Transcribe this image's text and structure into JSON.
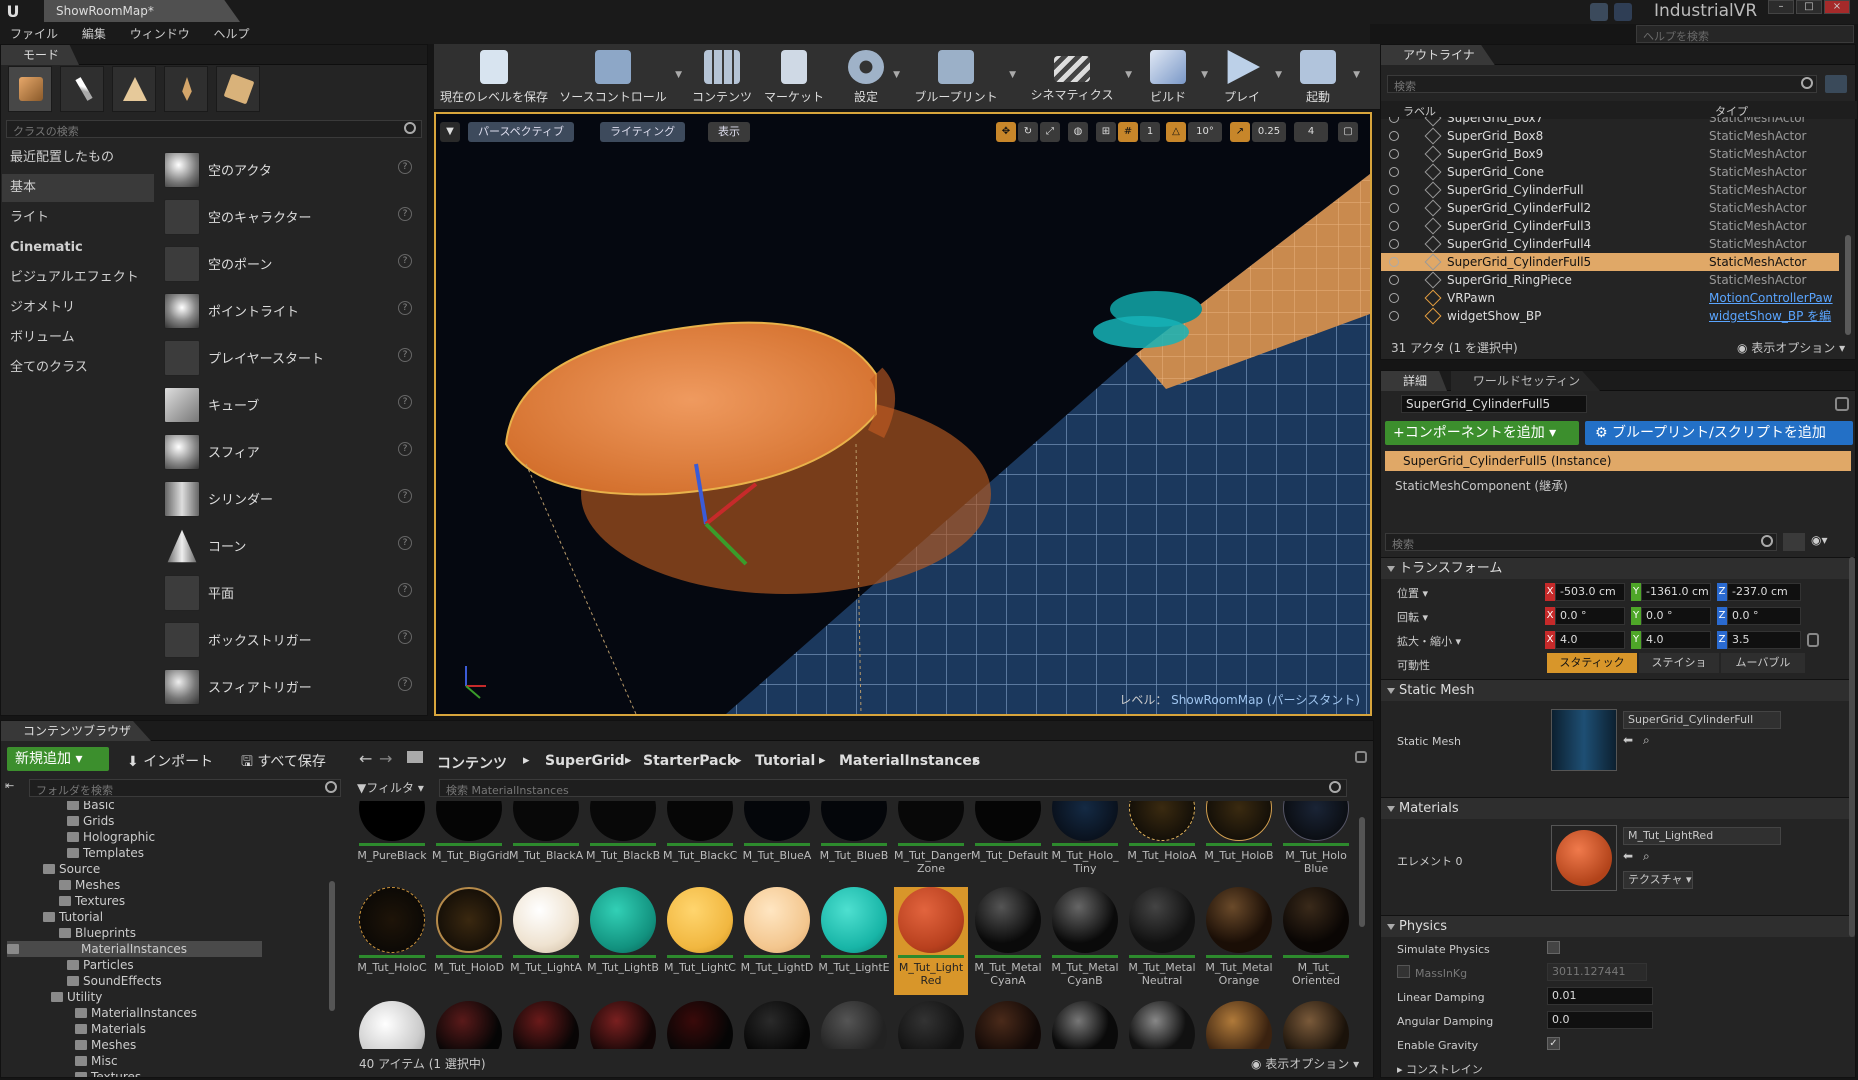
{
  "window": {
    "doc_tab": "ShowRoomMap*",
    "project_name": "IndustrialVR",
    "help_search_placeholder": "ヘルプを検索"
  },
  "menu": [
    "ファイル",
    "編集",
    "ウィンドウ",
    "ヘルプ"
  ],
  "modes": {
    "tab": "モード",
    "search_placeholder": "クラスの検索",
    "categories": [
      "最近配置したもの",
      "基本",
      "ライト",
      "Cinematic",
      "ビジュアルエフェクト",
      "ジオメトリ",
      "ボリューム",
      "全てのクラス"
    ],
    "items": [
      "空のアクタ",
      "空のキャラクター",
      "空のポーン",
      "ポイントライト",
      "プレイヤースタート",
      "キューブ",
      "スフィア",
      "シリンダー",
      "コーン",
      "平面",
      "ボックストリガー",
      "スフィアトリガー"
    ]
  },
  "toolbar": [
    "現在のレベルを保存",
    "ソースコントロール",
    "コンテンツ",
    "マーケット",
    "設定",
    "ブループリント",
    "シネマティクス",
    "ビルド",
    "プレイ",
    "起動"
  ],
  "viewport": {
    "perspective": "パースペクティブ",
    "lighting": "ライティング",
    "show": "表示",
    "rot_snap": "10°",
    "scale_snap": "0.25",
    "cam_speed": "4",
    "level_label": "レベル：",
    "level_name": "ShowRoomMap (パーシスタント)"
  },
  "outliner": {
    "tab": "アウトライナ",
    "search_placeholder": "検索",
    "col_label": "ラベル",
    "col_type": "タイプ",
    "rows": [
      {
        "name": "SuperGrid_Box7",
        "type": "StaticMeshActor"
      },
      {
        "name": "SuperGrid_Box8",
        "type": "StaticMeshActor"
      },
      {
        "name": "SuperGrid_Box9",
        "type": "StaticMeshActor"
      },
      {
        "name": "SuperGrid_Cone",
        "type": "StaticMeshActor"
      },
      {
        "name": "SuperGrid_CylinderFull",
        "type": "StaticMeshActor"
      },
      {
        "name": "SuperGrid_CylinderFull2",
        "type": "StaticMeshActor"
      },
      {
        "name": "SuperGrid_CylinderFull3",
        "type": "StaticMeshActor"
      },
      {
        "name": "SuperGrid_CylinderFull4",
        "type": "StaticMeshActor"
      },
      {
        "name": "SuperGrid_CylinderFull5",
        "type": "StaticMeshActor"
      },
      {
        "name": "SuperGrid_RingPiece",
        "type": "StaticMeshActor"
      },
      {
        "name": "VRPawn",
        "type": "MotionControllerPaw"
      },
      {
        "name": "widgetShow_BP",
        "type": "widgetShow_BP を編"
      }
    ],
    "count": "31 アクタ (1 を選択中)",
    "view_options": "表示オプション"
  },
  "details": {
    "tab": "詳細",
    "tab2": "ワールドセッティン",
    "actor_name": "SuperGrid_CylinderFull5",
    "add_component": "+コンポーネントを追加",
    "add_blueprint": "ブループリント/スクリプトを追加",
    "instance": "SuperGrid_CylinderFull5 (Instance)",
    "component": "StaticMeshComponent (継承)",
    "search_placeholder": "検索",
    "transform_header": "トランスフォーム",
    "location_label": "位置",
    "rotation_label": "回転",
    "scale_label": "拡大・縮小",
    "mobility_label": "可動性",
    "location": [
      "-503.0 cm",
      "-1361.0 cm",
      "-237.0 cm"
    ],
    "rotation": [
      "0.0 °",
      "0.0 °",
      "0.0 °"
    ],
    "scale": [
      "4.0",
      "4.0",
      "3.5"
    ],
    "mobility": [
      "スタティック",
      "ステイショ",
      "ムーバブル"
    ],
    "static_mesh_header": "Static Mesh",
    "static_mesh_label": "Static Mesh",
    "static_mesh_value": "SuperGrid_CylinderFull",
    "materials_header": "Materials",
    "element_label": "エレメント 0",
    "material_value": "M_Tut_LightRed",
    "texture_btn": "テクスチャ",
    "physics_header": "Physics",
    "simulate_physics": "Simulate Physics",
    "mass": "MassInKg",
    "mass_value": "3011.127441",
    "linear_damping": "Linear Damping",
    "linear_damping_value": "0.01",
    "angular_damping": "Angular Damping",
    "angular_damping_value": "0.0",
    "enable_gravity": "Enable Gravity",
    "constraints": "コンストレイン"
  },
  "content": {
    "tab": "コンテンツブラウザ",
    "add_new": "新規追加",
    "import": "インポート",
    "save_all": "すべて保存",
    "breadcrumb": [
      "コンテンツ",
      "SuperGrid",
      "StarterPack",
      "Tutorial",
      "MaterialInstances"
    ],
    "folder_search": "フォルダを検索",
    "filter": "フィルタ",
    "asset_search": "検索 MaterialInstances",
    "folders": [
      "Basic",
      "Grids",
      "Holographic",
      "Templates",
      "Source",
      "Meshes",
      "Textures",
      "Tutorial",
      "Blueprints",
      "MaterialInstances",
      "Particles",
      "SoundEffects",
      "Utility",
      "MaterialInstances",
      "Materials",
      "Meshes",
      "Misc",
      "Textures"
    ],
    "row1": [
      "M_PureBlack",
      "M_Tut_BigGrid",
      "M_Tut_BlackA",
      "M_Tut_BlackB",
      "M_Tut_BlackC",
      "M_Tut_BlueA",
      "M_Tut_BlueB",
      "M_Tut_Danger Zone",
      "M_Tut_Default",
      "M_Tut_Holo_ Tiny",
      "M_Tut_HoloA",
      "M_Tut_HoloB",
      "M_Tut_Holo Blue"
    ],
    "row2": [
      "M_Tut_HoloC",
      "M_Tut_HoloD",
      "M_Tut_LightA",
      "M_Tut_LightB",
      "M_Tut_LightC",
      "M_Tut_LightD",
      "M_Tut_LightE",
      "M_Tut_Light Red",
      "M_Tut_Metal CyanA",
      "M_Tut_Metal CyanB",
      "M_Tut_Metal Neutral",
      "M_Tut_Metal Orange",
      "M_Tut_ Oriented"
    ],
    "count": "40 アイテム (1 選択中)",
    "view_options": "表示オプション"
  },
  "colors": {
    "accent": "#d8962a",
    "selection": "#e0a867",
    "green": "#3c8f2d",
    "blue": "#2370c6"
  }
}
